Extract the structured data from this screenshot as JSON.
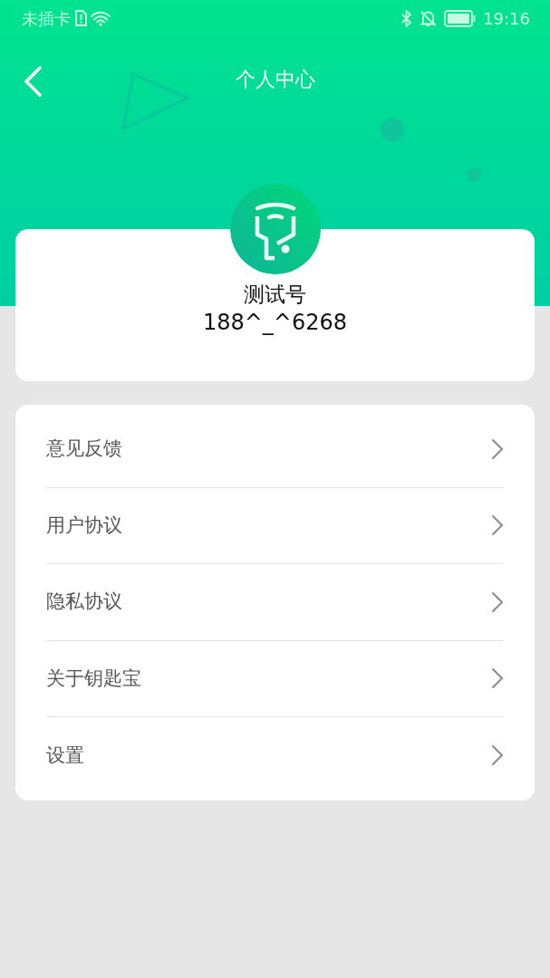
{
  "status_bar": {
    "carrier": "未插卡",
    "time": "19:16"
  },
  "header": {
    "title": "个人中心"
  },
  "profile": {
    "name": "测试号",
    "phone": "188^_^6268"
  },
  "menu": [
    {
      "label": "意见反馈"
    },
    {
      "label": "用户协议"
    },
    {
      "label": "隐私协议"
    },
    {
      "label": "关于钥匙宝"
    },
    {
      "label": "设置"
    }
  ]
}
